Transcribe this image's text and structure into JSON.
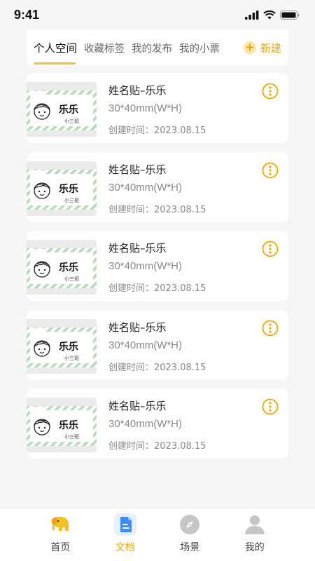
{
  "status": {
    "time": "9:41"
  },
  "tabs": [
    {
      "label": "个人空间",
      "active": true
    },
    {
      "label": "收藏标签",
      "active": false
    },
    {
      "label": "我的发布",
      "active": false
    },
    {
      "label": "我的小票",
      "active": false
    }
  ],
  "new_button": {
    "label": "新建",
    "icon": "plus-icon"
  },
  "items": [
    {
      "title": "姓名贴–乐乐",
      "size": "30*40mm(W*H)",
      "date": "创建时间：2023.08.15",
      "thumb_name": "乐乐",
      "thumb_sub": "小三班"
    },
    {
      "title": "姓名贴–乐乐",
      "size": "30*40mm(W*H)",
      "date": "创建时间：2023.08.15",
      "thumb_name": "乐乐",
      "thumb_sub": "小三班"
    },
    {
      "title": "姓名贴–乐乐",
      "size": "30*40mm(W*H)",
      "date": "创建时间：2023.08.15",
      "thumb_name": "乐乐",
      "thumb_sub": "小三班"
    },
    {
      "title": "姓名贴–乐乐",
      "size": "30*40mm(W*H)",
      "date": "创建时间：2023.08.15",
      "thumb_name": "乐乐",
      "thumb_sub": "小三班"
    },
    {
      "title": "姓名贴–乐乐",
      "size": "30*40mm(W*H)",
      "date": "创建时间：2023.08.15",
      "thumb_name": "乐乐",
      "thumb_sub": "小三班"
    }
  ],
  "nav": [
    {
      "label": "首页",
      "icon": "elephant-icon",
      "active": false
    },
    {
      "label": "文档",
      "icon": "document-icon",
      "active": true
    },
    {
      "label": "场景",
      "icon": "compass-icon",
      "active": false
    },
    {
      "label": "我的",
      "icon": "user-icon",
      "active": false
    }
  ],
  "colors": {
    "accent": "#f0a800",
    "accent_light": "#f6c22c",
    "label_stripe": "#b9dcc0",
    "background": "#f6f6f6"
  }
}
